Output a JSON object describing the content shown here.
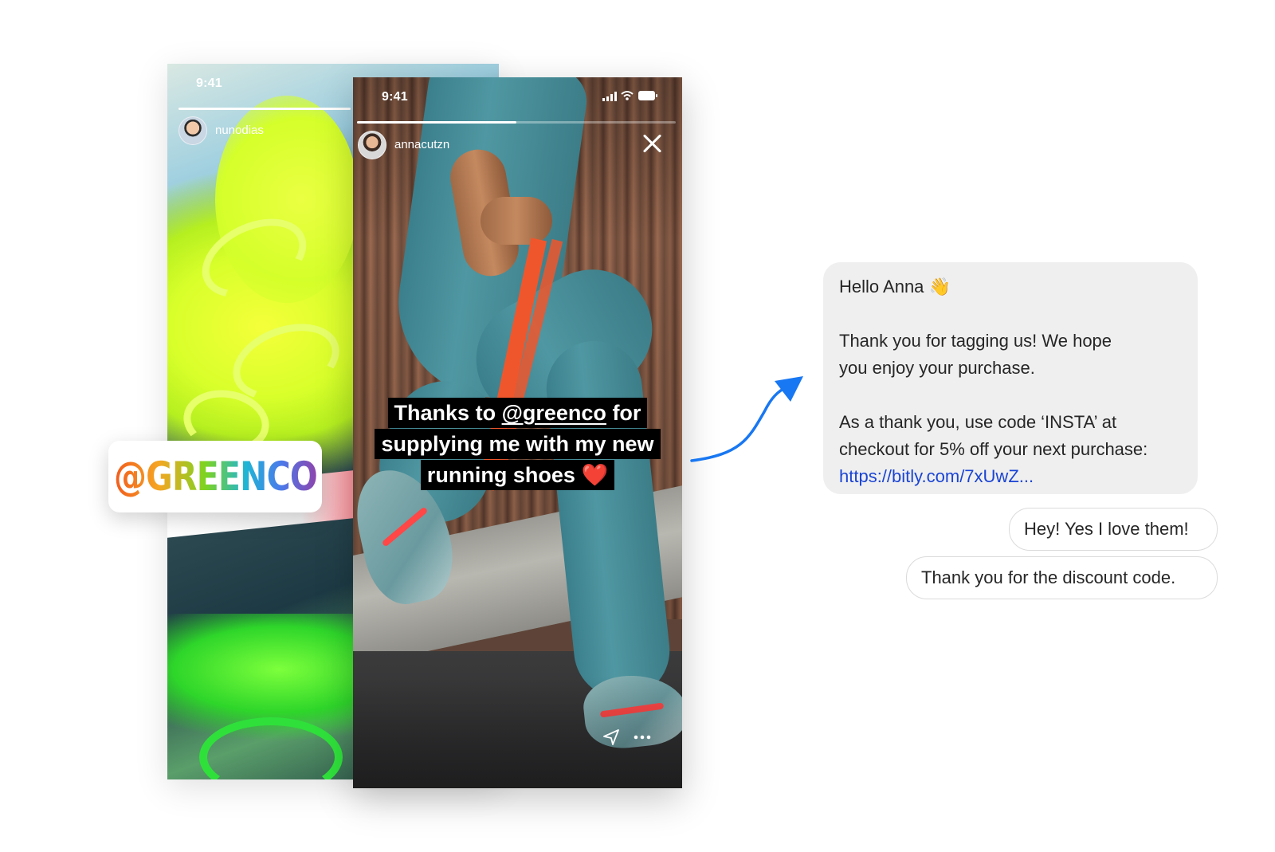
{
  "back_story": {
    "time": "9:41",
    "username": "nunodias",
    "progress": 1.0
  },
  "front_story": {
    "time": "9:41",
    "username": "annacutzn",
    "progress": 0.5,
    "caption": {
      "line1_pre": "Thanks to ",
      "mention": "@greenco",
      "line1_post": " for",
      "line2": "supplying me with my new",
      "line3": "running shoes",
      "heart": "❤️"
    },
    "icons": [
      "signal-icon",
      "wifi-icon",
      "battery-icon",
      "close-icon",
      "send-icon",
      "more-icon"
    ]
  },
  "sticker": {
    "text": "@GREENCO"
  },
  "messages": {
    "incoming": {
      "greeting": "Hello Anna 👋",
      "line2": "Thank you for tagging us! We hope",
      "line3": "you enjoy your purchase.",
      "line4": "As a thank you, use code ‘INSTA’ at",
      "line5": "checkout for 5% off your next purchase:",
      "link": "https://bitly.com/7xUwZ..."
    },
    "outgoing": [
      "Hey! Yes I love them!",
      "Thank you for the discount code."
    ]
  },
  "colors": {
    "arrow": "#1877f2",
    "link": "#1a44d4",
    "incoming_bubble": "#efefef",
    "outgoing_border": "#dbdbdb",
    "caption_bg": "#000000",
    "band": "#f0562c"
  }
}
